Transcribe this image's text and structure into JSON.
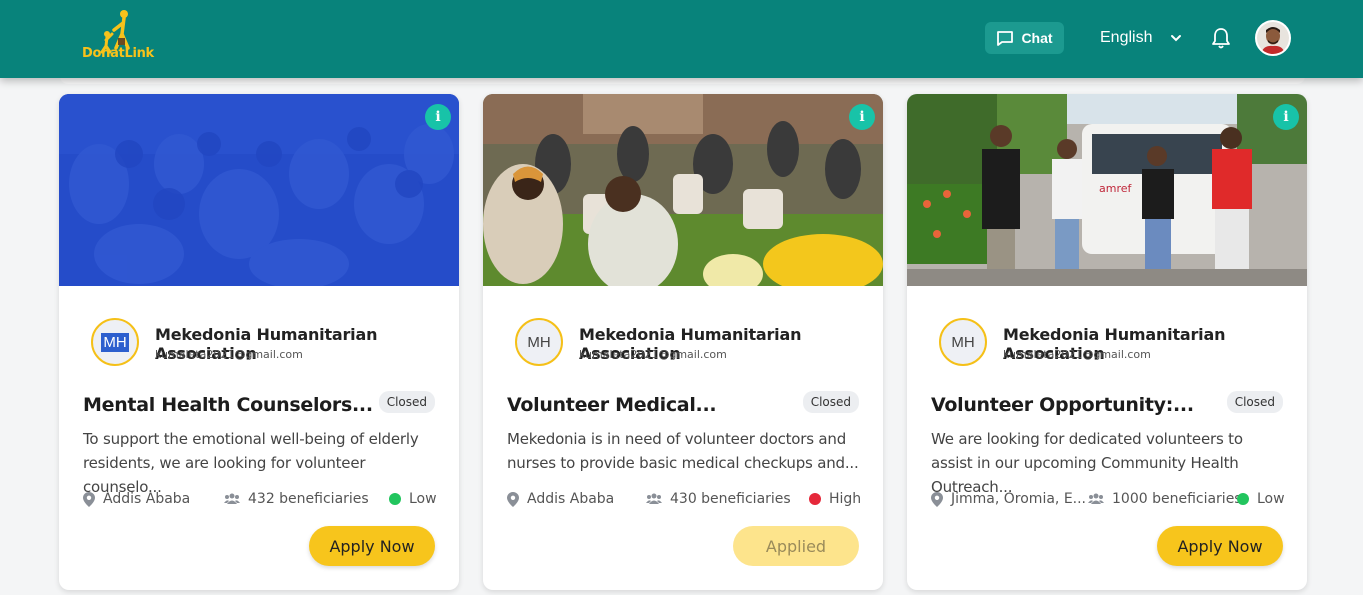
{
  "header": {
    "logo_text": "DonatLink",
    "chat_label": "Chat",
    "language": "English"
  },
  "colors": {
    "header_bg": "#08837b",
    "accent_yellow": "#f7c51c",
    "info_teal": "#18c3a8",
    "low_green": "#22c55e",
    "high_red": "#e5283a"
  },
  "cards": [
    {
      "org_initials": "MH",
      "org_name": "Mekedonia Humanitarian Association",
      "org_email": "kumaleta2021@gmail.com",
      "title": "Mental Health Counselors...",
      "status": "Closed",
      "description": "To support the emotional well-being of elderly residents, we are looking for volunteer counselo...",
      "location": "Addis Ababa",
      "beneficiaries": "432 beneficiaries",
      "priority": "Low",
      "button": "Apply Now"
    },
    {
      "org_initials": "MH",
      "org_name": "Mekedonia Humanitarian Association",
      "org_email": "kumaleta2021@gmail.com",
      "title": "Volunteer Medical...",
      "status": "Closed",
      "description": "Mekedonia is in need of volunteer doctors and nurses to provide basic medical checkups and...",
      "location": "Addis Ababa",
      "beneficiaries": "430 beneficiaries",
      "priority": "High",
      "button": "Applied"
    },
    {
      "org_initials": "MH",
      "org_name": "Mekedonia Humanitarian Association",
      "org_email": "kumaleta2021@gmail.com",
      "title": "Volunteer Opportunity:...",
      "status": "Closed",
      "description": "We are looking for dedicated volunteers to assist in our upcoming Community Health Outreach...",
      "location": "Jimma, Oromia, E...",
      "beneficiaries": "1000 beneficiaries",
      "priority": "Low",
      "button": "Apply Now"
    }
  ],
  "icons": {
    "chat": "chat-bubble-icon",
    "language": "chevron-down-icon",
    "notifications": "bell-icon",
    "info": "info-icon",
    "location": "map-pin-icon",
    "beneficiaries": "users-icon"
  }
}
